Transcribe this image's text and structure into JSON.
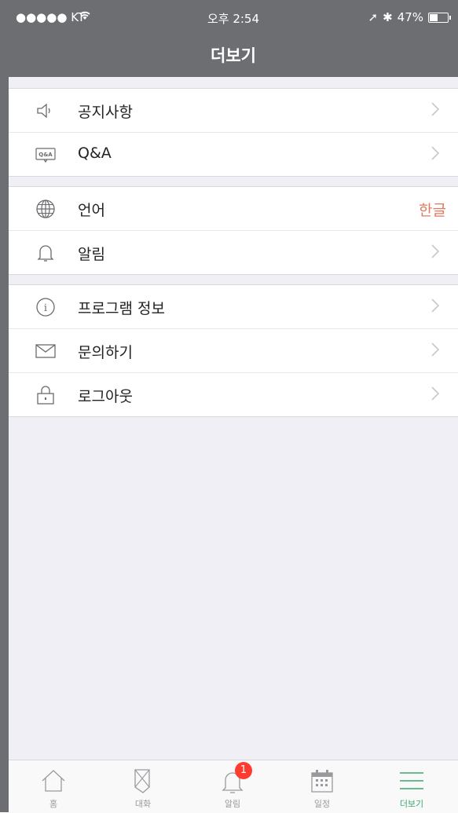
{
  "status": {
    "carrier": "●●●●● KT",
    "time": "오후 2:54",
    "battery": "47%"
  },
  "header": {
    "title": "더보기"
  },
  "groups": [
    {
      "items": [
        {
          "label": "공지사항",
          "icon": "speaker-icon"
        },
        {
          "label": "Q&A",
          "icon": "qa-icon",
          "icon_text": "Q&A"
        }
      ]
    },
    {
      "items": [
        {
          "label": "언어",
          "icon": "globe-icon",
          "value": "한글"
        },
        {
          "label": "알림",
          "icon": "bell-icon"
        }
      ]
    },
    {
      "items": [
        {
          "label": "프로그램 정보",
          "icon": "info-icon"
        },
        {
          "label": "문의하기",
          "icon": "mail-icon"
        },
        {
          "label": "로그아웃",
          "icon": "lock-icon"
        }
      ]
    }
  ],
  "tabbar": {
    "tabs": [
      {
        "label": "홈",
        "icon": "home-icon"
      },
      {
        "label": "대화",
        "icon": "chat-icon"
      },
      {
        "label": "알림",
        "icon": "bell-icon",
        "badge": "1"
      },
      {
        "label": "일정",
        "icon": "calendar-icon"
      },
      {
        "label": "더보기",
        "icon": "menu-icon",
        "active": true
      }
    ]
  },
  "colors": {
    "header_bg": "#6d6e72",
    "accent": "#3aa76d",
    "value_text": "#e07a5f",
    "badge": "#ff3b30"
  }
}
